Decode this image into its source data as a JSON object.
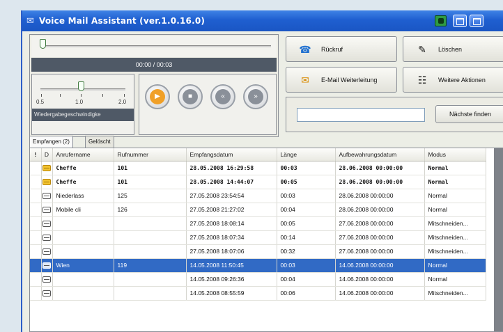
{
  "window": {
    "title": "Voice Mail Assistant (ver.1.0.16.0)",
    "app_icon": "envelope-app-icon"
  },
  "player": {
    "position_fraction": 0.0,
    "time_display": "00:00 / 00:03",
    "speed": {
      "value": 1.0,
      "labels": [
        "0.5",
        "1.0",
        "2.0"
      ],
      "caption": "Wiedergabegeschwindigke"
    },
    "controls": {
      "play_icon": "play-icon",
      "stop_icon": "stop-icon",
      "rewind_icon": "rewind-icon",
      "forward_icon": "forward-icon"
    }
  },
  "actions": {
    "callback": "Rückruf",
    "delete": "Löschen",
    "email_forward": "E-Mail Weiterleitung",
    "more_actions": "Weitere Aktionen"
  },
  "find": {
    "value": "",
    "button": "Nächste finden"
  },
  "tabs": [
    {
      "label": "Empfangen (2)",
      "active": true
    },
    {
      "label": "Gelöscht",
      "active": false
    }
  ],
  "table": {
    "columns": [
      "!",
      "D",
      "Anrufername",
      "Rufnummer",
      "Empfangsdatum",
      "Länge",
      "Aufbewahrungsdatum",
      "Modus"
    ],
    "rows": [
      {
        "icon": "new-message-icon",
        "unread": true,
        "selected": false,
        "name": "Cheffe",
        "number": "101",
        "received": "28.05.2008 16:29:58",
        "length": "00:03",
        "retention": "28.06.2008 00:00:00",
        "mode": "Normal"
      },
      {
        "icon": "new-message-icon",
        "unread": true,
        "selected": false,
        "name": "Cheffe",
        "number": "101",
        "received": "28.05.2008 14:44:07",
        "length": "00:05",
        "retention": "28.06.2008 00:00:00",
        "mode": "Normal"
      },
      {
        "icon": "read-message-icon",
        "unread": false,
        "selected": false,
        "name": "Niederlass",
        "number": "125",
        "received": "27.05.2008 23:54:54",
        "length": "00:03",
        "retention": "28.06.2008 00:00:00",
        "mode": "Normal"
      },
      {
        "icon": "read-message-icon",
        "unread": false,
        "selected": false,
        "name": "Mobile cli",
        "number": "126",
        "received": "27.05.2008 21:27:02",
        "length": "00:04",
        "retention": "28.06.2008 00:00:00",
        "mode": "Normal"
      },
      {
        "icon": "read-message-icon",
        "unread": false,
        "selected": false,
        "name": "",
        "number": "",
        "received": "27.05.2008 18:08:14",
        "length": "00:05",
        "retention": "27.06.2008 00:00:00",
        "mode": "Mitschneiden..."
      },
      {
        "icon": "read-message-icon",
        "unread": false,
        "selected": false,
        "name": "",
        "number": "",
        "received": "27.05.2008 18:07:34",
        "length": "00:14",
        "retention": "27.06.2008 00:00:00",
        "mode": "Mitschneiden..."
      },
      {
        "icon": "read-message-icon",
        "unread": false,
        "selected": false,
        "name": "",
        "number": "",
        "received": "27.05.2008 18:07:06",
        "length": "00:32",
        "retention": "27.06.2008 00:00:00",
        "mode": "Mitschneiden..."
      },
      {
        "icon": "read-message-icon",
        "unread": false,
        "selected": true,
        "name": "Wien",
        "number": "119",
        "received": "14.05.2008 11:50:45",
        "length": "00:03",
        "retention": "14.06.2008 00:00:00",
        "mode": "Normal"
      },
      {
        "icon": "read-message-icon",
        "unread": false,
        "selected": false,
        "name": "",
        "number": "",
        "received": "14.05.2008 09:26:36",
        "length": "00:04",
        "retention": "14.06.2008 00:00:00",
        "mode": "Normal"
      },
      {
        "icon": "read-message-icon",
        "unread": false,
        "selected": false,
        "name": "",
        "number": "",
        "received": "14.05.2008 08:55:59",
        "length": "00:06",
        "retention": "14.06.2008 00:00:00",
        "mode": "Mitschneiden..."
      }
    ]
  }
}
